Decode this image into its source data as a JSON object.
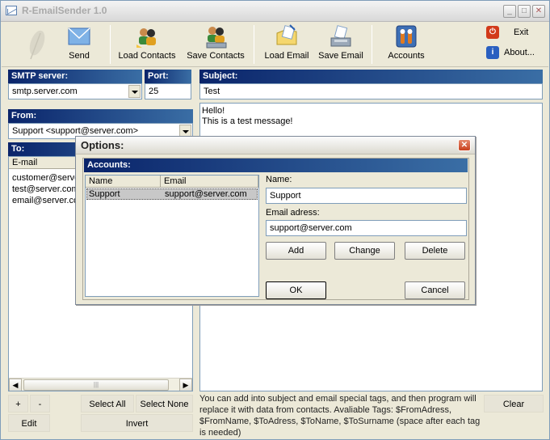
{
  "window": {
    "title": "R-EmailSender 1.0"
  },
  "toolbar": {
    "buttons": [
      {
        "label": "Send",
        "icon": "envelope-icon"
      },
      {
        "label": "Load Contacts",
        "icon": "contacts-load-icon"
      },
      {
        "label": "Save Contacts",
        "icon": "contacts-save-icon"
      },
      {
        "label": "Load Email",
        "icon": "email-load-icon"
      },
      {
        "label": "Save Email",
        "icon": "email-save-icon"
      },
      {
        "label": "Accounts",
        "icon": "accounts-icon"
      }
    ],
    "exit_label": "Exit",
    "about_label": "About..."
  },
  "smtp": {
    "label": "SMTP server:",
    "value": "smtp.server.com"
  },
  "port": {
    "label": "Port:",
    "value": "25"
  },
  "subject": {
    "label": "Subject:",
    "value": "Test"
  },
  "from": {
    "label": "From:",
    "value": "Support <support@server.com>"
  },
  "to": {
    "label": "To:",
    "column": "E-mail",
    "rows": [
      "customer@server.com",
      "test@server.com",
      "email@server.com"
    ]
  },
  "body": {
    "line1": "Hello!",
    "line2": "This is a test message!"
  },
  "bottom": {
    "plus": "+",
    "minus": "-",
    "edit": "Edit",
    "select_all": "Select All",
    "select_none": "Select None",
    "invert": "Invert",
    "clear": "Clear",
    "help": "You can add into subject and email special tags, and then program will replace it with data from contacts.   Avaliable Tags: $FromAdress, $FromName, $ToAdress, $ToName, $ToSurname   (space after each tag is needed)"
  },
  "options": {
    "title": "Options:",
    "accounts_label": "Accounts:",
    "columns": [
      "Name",
      "Email"
    ],
    "accounts": [
      {
        "name": "Support",
        "email": "support@server.com"
      }
    ],
    "name_label": "Name:",
    "name_value": "Support",
    "email_label": "Email adress:",
    "email_value": "support@server.com",
    "add": "Add",
    "change": "Change",
    "delete": "Delete",
    "ok": "OK",
    "cancel": "Cancel"
  }
}
